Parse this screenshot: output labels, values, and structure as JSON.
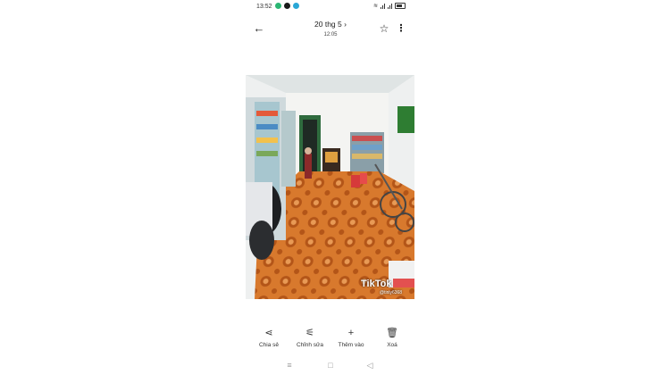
{
  "status": {
    "time": "13:52",
    "apps": [
      {
        "name": "app-icon",
        "color": "#2bb673"
      },
      {
        "name": "facebook-icon",
        "color": "#1a1a1a"
      },
      {
        "name": "app-icon",
        "color": "#2aa7d6"
      }
    ]
  },
  "header": {
    "title": "20 thg 5 ›",
    "subtitle": "12:05"
  },
  "photo": {
    "watermark": "TikTok",
    "username": "@tinly6368"
  },
  "actions": [
    {
      "label": "Chia sẻ",
      "icon": "share-icon"
    },
    {
      "label": "Chỉnh sửa",
      "icon": "edit-icon"
    },
    {
      "label": "Thêm vào",
      "icon": "add-icon"
    },
    {
      "label": "Xoá",
      "icon": "delete-icon"
    }
  ],
  "colors": {
    "floor": "#d3752b",
    "wall": "#f0f0f0",
    "background": "#ffffff"
  }
}
